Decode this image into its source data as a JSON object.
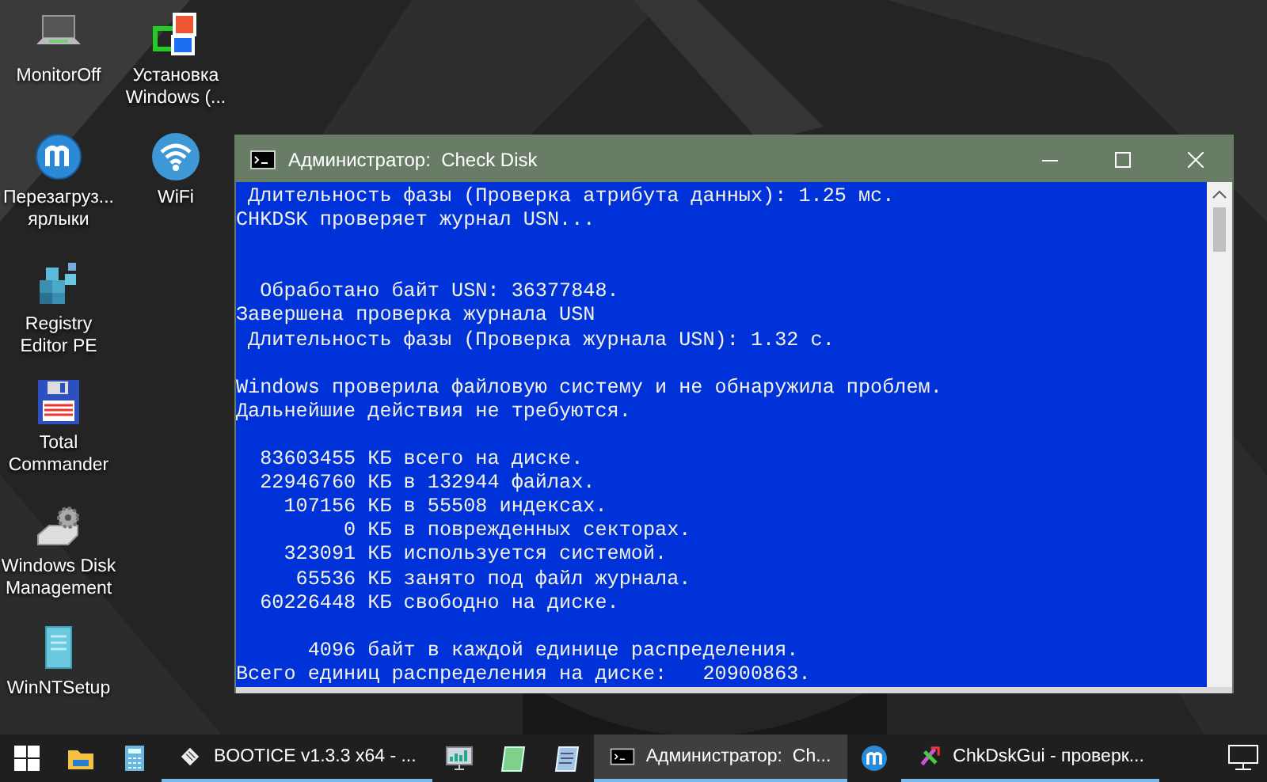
{
  "desktop": {
    "shortcuts": [
      {
        "label": "MonitorOff"
      },
      {
        "label": "Установка Windows (..."
      },
      {
        "label": "Перезагруз... ярлыки"
      },
      {
        "label": "WiFi"
      },
      {
        "label": "Registry Editor PE"
      },
      {
        "label": "Total Commander"
      },
      {
        "label": "Windows Disk Management"
      },
      {
        "label": "WinNTSetup"
      }
    ]
  },
  "console": {
    "title": "Администратор:  Check Disk",
    "lines": [
      {
        "kind": "text",
        "text": " Длительность фазы (Проверка атрибута данных): 1.25 мс."
      },
      {
        "kind": "text",
        "text": "CHKDSK проверяет журнал USN..."
      },
      {
        "kind": "blank"
      },
      {
        "kind": "blank"
      },
      {
        "kind": "text",
        "text": "  Обработано байт USN: 36377848."
      },
      {
        "kind": "text",
        "text": "Завершена проверка журнала USN"
      },
      {
        "kind": "text",
        "text": " Длительность фазы (Проверка журнала USN): 1.32 с."
      },
      {
        "kind": "blank"
      },
      {
        "kind": "text",
        "text": "Windows проверила файловую систему и не обнаружила проблем."
      },
      {
        "kind": "text",
        "text": "Дальнейшие действия не требуются."
      },
      {
        "kind": "blank"
      },
      {
        "kind": "text",
        "text": "  83603455 КБ всего на диске."
      },
      {
        "kind": "text",
        "text": "  22946760 КБ в 132944 файлах."
      },
      {
        "kind": "text",
        "text": "    107156 КБ в 55508 индексах."
      },
      {
        "kind": "text",
        "text": "         0 КБ в поврежденных секторах."
      },
      {
        "kind": "text",
        "text": "    323091 КБ используется системой."
      },
      {
        "kind": "text",
        "text": "     65536 КБ занято под файл журнала."
      },
      {
        "kind": "text",
        "text": "  60226448 КБ свободно на диске."
      },
      {
        "kind": "blank"
      },
      {
        "kind": "text",
        "text": "      4096 байт в каждой единице распределения."
      },
      {
        "kind": "text",
        "text": "Всего единиц распределения на диске:   20900863."
      }
    ]
  },
  "taskbar": {
    "items": [
      {
        "kind": "start"
      },
      {
        "kind": "icon"
      },
      {
        "kind": "icon"
      },
      {
        "kind": "app",
        "label": "BOOTICE v1.3.3 x64 - ...",
        "selected": false
      },
      {
        "kind": "icon"
      },
      {
        "kind": "icon"
      },
      {
        "kind": "icon"
      },
      {
        "kind": "app",
        "label": "Администратор:  Ch...",
        "selected": true
      },
      {
        "kind": "icon"
      },
      {
        "kind": "app",
        "label": "ChkDskGui - проверк...",
        "selected": false
      }
    ]
  }
}
